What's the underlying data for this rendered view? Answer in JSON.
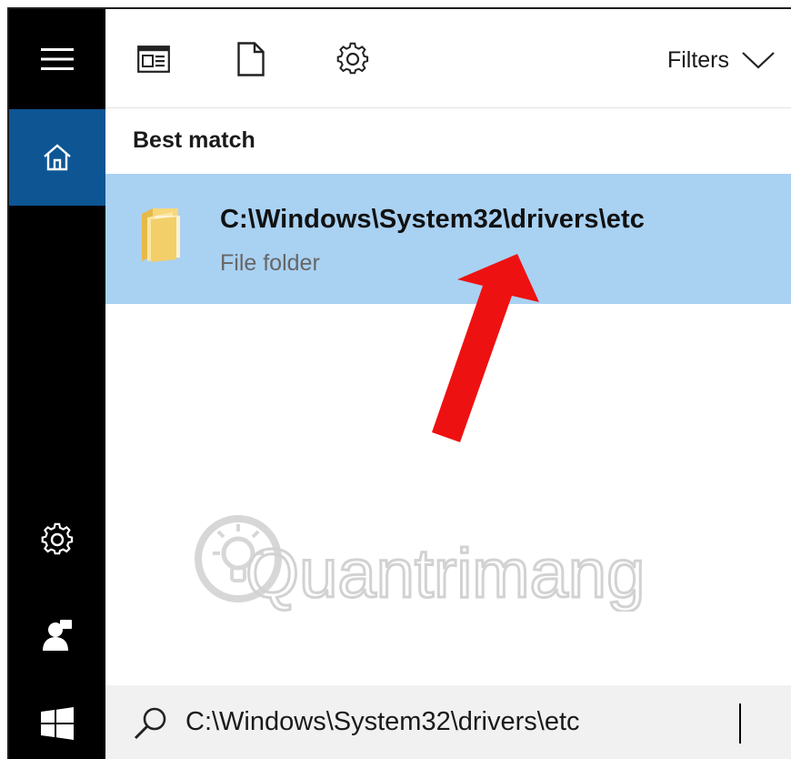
{
  "toolbar": {
    "filters_label": "Filters",
    "icons": [
      "apps-icon",
      "documents-icon",
      "settings-icon",
      "chevron-down-icon"
    ]
  },
  "sidebar": {
    "icons": [
      "hamburger-menu-icon",
      "home-icon",
      "settings-icon",
      "user-icon",
      "windows-start-icon"
    ],
    "active": "home"
  },
  "results": {
    "heading": "Best match",
    "items": [
      {
        "title": "C:\\Windows\\System32\\drivers\\etc",
        "subtitle": "File folder",
        "icon": "folder-icon",
        "selected": true
      }
    ]
  },
  "search": {
    "value": "C:\\Windows\\System32\\drivers\\etc",
    "icon": "search-icon"
  },
  "watermark": {
    "text": "Quantrimang"
  },
  "colors": {
    "rail": "#000000",
    "rail_active": "#0e5594",
    "selection": "#a9d1f2",
    "annotation_arrow": "#ee1111",
    "search_bg": "#f1f1f1"
  }
}
